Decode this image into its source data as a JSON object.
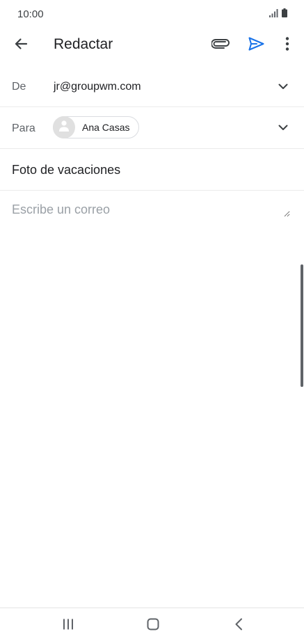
{
  "status_bar": {
    "time": "10:00",
    "icons": [
      "signal-icon",
      "battery-icon"
    ]
  },
  "app_bar": {
    "back_icon": "arrow-left-icon",
    "title": "Redactar",
    "attach_icon": "paperclip-icon",
    "send_icon": "send-icon",
    "more_icon": "more-vert-icon",
    "accent_color": "#1a73e8"
  },
  "compose": {
    "from_label": "De",
    "from_value": "jr@groupwm.com",
    "to_label": "Para",
    "recipients": [
      {
        "name": "Ana Casas",
        "avatar_icon": "person-icon"
      }
    ],
    "subject": "Foto de vacaciones",
    "body_placeholder": "Escribe un correo",
    "body_value": ""
  },
  "nav_bar": {
    "recents_icon": "recent-apps-icon",
    "home_icon": "home-icon",
    "back_icon": "nav-back-icon"
  }
}
